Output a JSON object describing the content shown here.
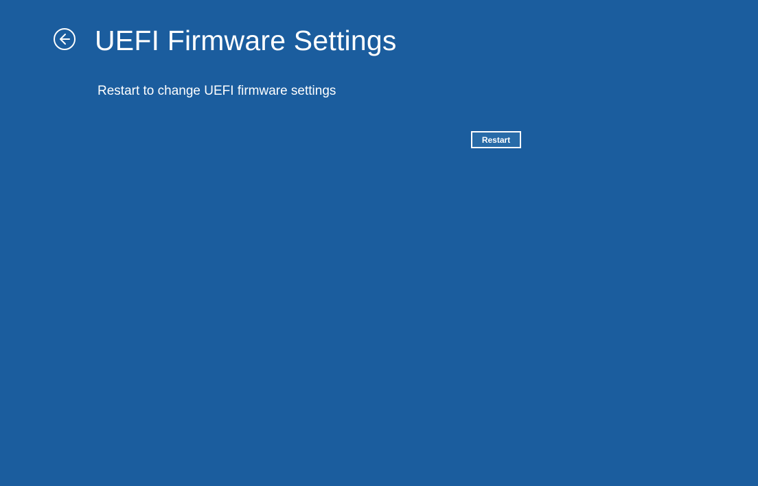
{
  "header": {
    "title": "UEFI Firmware Settings"
  },
  "main": {
    "description": "Restart to change UEFI firmware settings",
    "restart_label": "Restart"
  }
}
